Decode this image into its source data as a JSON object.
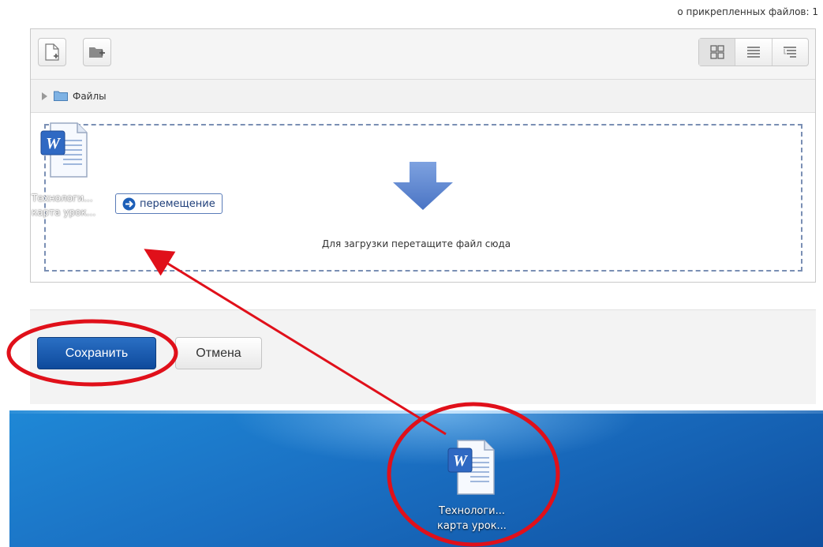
{
  "files_count_text": "о прикрепленных файлов: 1",
  "toolbar": {
    "add_file_icon": "add-file-icon",
    "create_folder_icon": "create-folder-icon",
    "views": [
      "icons-view-icon",
      "list-view-icon",
      "tree-view-icon"
    ]
  },
  "path": {
    "folder_label": "Файлы"
  },
  "drop_zone": {
    "instruction": "Для загрузки перетащите файл сюда",
    "dragged_file": {
      "name_line1": "Технологи...",
      "name_line2": "карта урок...",
      "icon": "word-document-icon"
    },
    "move_tooltip": "перемещение"
  },
  "buttons": {
    "save": "Сохранить",
    "cancel": "Отмена"
  },
  "desktop_file": {
    "name_line1": "Технологи...",
    "name_line2": "карта урок...",
    "icon": "word-document-icon"
  },
  "colors": {
    "primary": "#0e4a9c",
    "annotation": "#e0101a",
    "desktop": "#1a6fc2",
    "drop_border": "#7a8fb4"
  }
}
